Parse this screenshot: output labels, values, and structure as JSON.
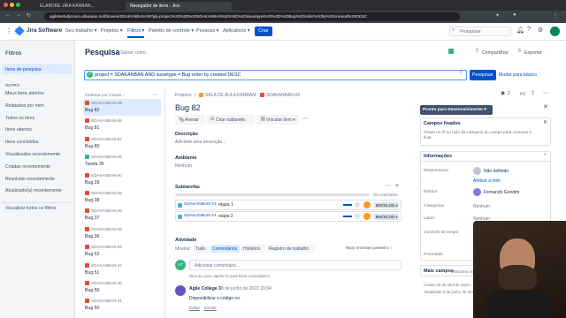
{
  "browser": {
    "tabs": [
      "ELABORE JIRA KANBAN...",
      "Navegador de itens - Jira"
    ],
    "url": "agiletestudyroom.atlassian.net/browse/SDAKANBAN-69?jql=project%20%3D%20SDAKANBAN%20AND%20issuetype%20%3D%20Bug%20order%20by%20created%20DESC"
  },
  "nav": {
    "logo": "Jira Software",
    "items": [
      "Seu trabalho ▾",
      "Projetos ▾",
      "Filtros ▾",
      "Painéis de controle ▾",
      "Pessoas ▾",
      "Aplicativos ▾"
    ],
    "create": "Criar",
    "search_placeholder": "Pesquisar"
  },
  "sidebar": {
    "title": "Filtros",
    "active": "Itens de pesquisa",
    "group": "OUTRO",
    "items": [
      "Meus itens abertos",
      "Relatados por mim",
      "Todos os itens",
      "Itens abertos",
      "Itens concluídos",
      "Visualizados recentemente",
      "Criadas recentemente",
      "Resolvido recentemente",
      "Atualizado(a) recentemente"
    ],
    "all_filters": "Visualizar todos os filtros"
  },
  "header": {
    "title": "Pesquisa",
    "save_as": "Salvar como",
    "share": "Compartilhar",
    "export": "Exportar"
  },
  "query": {
    "text": "project = SDAKANBAN AND issuetype = Bug order by created DESC",
    "search": "Pesquisar",
    "basic": "Mudar para básico"
  },
  "list": {
    "sort": "Ordenar por Criado ↓",
    "items": [
      {
        "key": "SDAKANBAN-69",
        "title": "Bug 82",
        "type": "bug"
      },
      {
        "key": "SDAKANBAN-68",
        "title": "Bug 81",
        "type": "bug"
      },
      {
        "key": "SDAKANBAN-67",
        "title": "Bug 80",
        "type": "bug"
      },
      {
        "key": "SDAKANBAN-66",
        "title": "Tarefa 35",
        "type": "story"
      },
      {
        "key": "SDAKANBAN-60",
        "title": "Bug 39",
        "type": "bug"
      },
      {
        "key": "SDAKANBAN-58",
        "title": "Bug 38",
        "type": "bug"
      },
      {
        "key": "SDAKANBAN-56",
        "title": "Bug 37",
        "type": "bug"
      },
      {
        "key": "SDAKANBAN-55",
        "title": "Bug 36",
        "type": "bug"
      },
      {
        "key": "SDAKANBAN-53",
        "title": "Bug 52",
        "type": "bug"
      },
      {
        "key": "SDAKANBAN-47",
        "title": "Bug 51",
        "type": "bug"
      },
      {
        "key": "SDAKANBAN-46",
        "title": "Bug 50",
        "type": "bug"
      },
      {
        "key": "SDAKANBAN-41",
        "title": "Bug 50",
        "type": "bug"
      }
    ]
  },
  "issue": {
    "crumbs": [
      "Projetos",
      "SALA DE AULA KANBAN",
      "SDAKANBAN-69"
    ],
    "title": "Bug 82",
    "actions": [
      "Anexar",
      "Criar subtarefa",
      "Vincular item ▾"
    ],
    "desc_label": "Descrição",
    "desc_ph": "Adicione uma descrição...",
    "env_label": "Ambiente",
    "env_val": "Nenhum",
    "sub_label": "Subtarefas",
    "sub_progress": "0% concluído",
    "subtasks": [
      {
        "key": "SDAKANBAN-73",
        "title": "etapa 1",
        "status": "BACKLOG ▾"
      },
      {
        "key": "SDAKANBAN-74",
        "title": "etapa 2",
        "status": "BACKLOG ▾"
      }
    ],
    "activity": "Atividade",
    "show": "Mostrar:",
    "act_tabs": [
      "Tudo",
      "Comentários",
      "Histórico",
      "Registro de trabalho"
    ],
    "act_sort": "Mais recentes primeiro ↕",
    "comment_ph": "Adicionar comentário...",
    "tip": "Dica do ouro: aperte M para fazer comentários",
    "comment_author": "Agile College 3",
    "comment_date": "8 de junho de 2022 20:04",
    "comment_text": "Disponibilizar o código no",
    "comment_actions": [
      "Editar",
      "Excluir"
    ],
    "commenter_initials": "VT"
  },
  "right": {
    "status": "Pronto para Desenvolvimento ▾",
    "watch_count": "2",
    "pinned_title": "Campos fixados",
    "pinned_text": "Clique no ✇ ao lado da categoria do campo para começar a fixar.",
    "info_title": "Informações",
    "fields": [
      {
        "l": "Responsável",
        "v": "Não definido"
      },
      {
        "l": "",
        "v": "Atribuir a mim"
      },
      {
        "l": "Relator",
        "v": "Fernando Gondim"
      },
      {
        "l": "Categorias",
        "v": "Nenhum"
      },
      {
        "l": "Label",
        "v": "Nenhum"
      },
      {
        "l": "Controle de tempo",
        "v": ""
      },
      {
        "l": "Prioridade",
        "v": ""
      }
    ],
    "more": "Mais campos",
    "more_hint": "Estimativa original, ...",
    "created": "Criado 28 de abril de 2022 ...",
    "updated": "Atualizado 8 de junho de 2022 ..."
  },
  "colors": {
    "accent": "#0052cc",
    "bug": "#e5493a",
    "status": "#42526e"
  }
}
